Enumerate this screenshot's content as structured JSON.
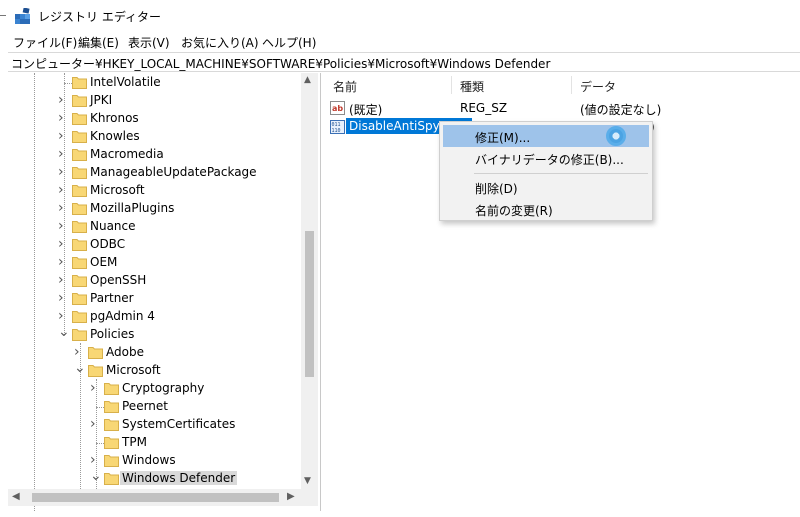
{
  "window": {
    "title": "レジストリ エディター",
    "app_icon": "registry-editor-icon"
  },
  "menu": [
    "ファイル(F)",
    "編集(E)",
    "表示(V)",
    "お気に入り(A)",
    "ヘルプ(H)"
  ],
  "address": "コンピューター¥HKEY_LOCAL_MACHINE¥SOFTWARE¥Policies¥Microsoft¥Windows Defender",
  "tree": {
    "items": [
      {
        "label": "IntelVolatile",
        "expandable": false,
        "selected": false
      },
      {
        "label": "JPKI",
        "expandable": true,
        "selected": false
      },
      {
        "label": "Khronos",
        "expandable": true,
        "selected": false
      },
      {
        "label": "Knowles",
        "expandable": true,
        "selected": false
      },
      {
        "label": "Macromedia",
        "expandable": true,
        "selected": false
      },
      {
        "label": "ManageableUpdatePackage",
        "expandable": true,
        "selected": false
      },
      {
        "label": "Microsoft",
        "expandable": true,
        "selected": false
      },
      {
        "label": "MozillaPlugins",
        "expandable": true,
        "selected": false
      },
      {
        "label": "Nuance",
        "expandable": true,
        "selected": false
      },
      {
        "label": "ODBC",
        "expandable": true,
        "selected": false
      },
      {
        "label": "OEM",
        "expandable": true,
        "selected": false
      },
      {
        "label": "OpenSSH",
        "expandable": true,
        "selected": false
      },
      {
        "label": "Partner",
        "expandable": true,
        "selected": false
      },
      {
        "label": "pgAdmin 4",
        "expandable": true,
        "selected": false
      },
      {
        "label": "Policies",
        "expandable": true,
        "expanded": true,
        "selected": false
      },
      {
        "label": "Adobe",
        "expandable": true,
        "selected": false
      },
      {
        "label": "Microsoft",
        "expandable": true,
        "expanded": true,
        "selected": false
      },
      {
        "label": "Cryptography",
        "expandable": true,
        "selected": false
      },
      {
        "label": "Peernet",
        "expandable": false,
        "selected": false
      },
      {
        "label": "SystemCertificates",
        "expandable": true,
        "selected": false
      },
      {
        "label": "TPM",
        "expandable": false,
        "selected": false
      },
      {
        "label": "Windows",
        "expandable": true,
        "selected": false
      },
      {
        "label": "Windows Defender",
        "expandable": true,
        "expanded": true,
        "selected": true
      }
    ]
  },
  "list": {
    "columns": [
      "名前",
      "種類",
      "データ"
    ],
    "rows": [
      {
        "name": "(既定)",
        "type": "REG_SZ",
        "data": "(値の設定なし)",
        "icon": "string-value-icon"
      },
      {
        "name": "DisableAntiSpyware",
        "type": "",
        "data": ")",
        "icon": "binary-value-icon",
        "editing": true
      }
    ]
  },
  "context_menu": {
    "items": [
      "修正(M)...",
      "バイナリデータの修正(B)...",
      "削除(D)",
      "名前の変更(R)"
    ],
    "highlighted_index": 0,
    "busy_cursor": "loading-cursor-icon"
  },
  "colors": {
    "selection": "#0078d7",
    "menu_highlight": "#9ec3ea",
    "folder": "#f8d775",
    "tree_selected": "#d9d9d9"
  }
}
